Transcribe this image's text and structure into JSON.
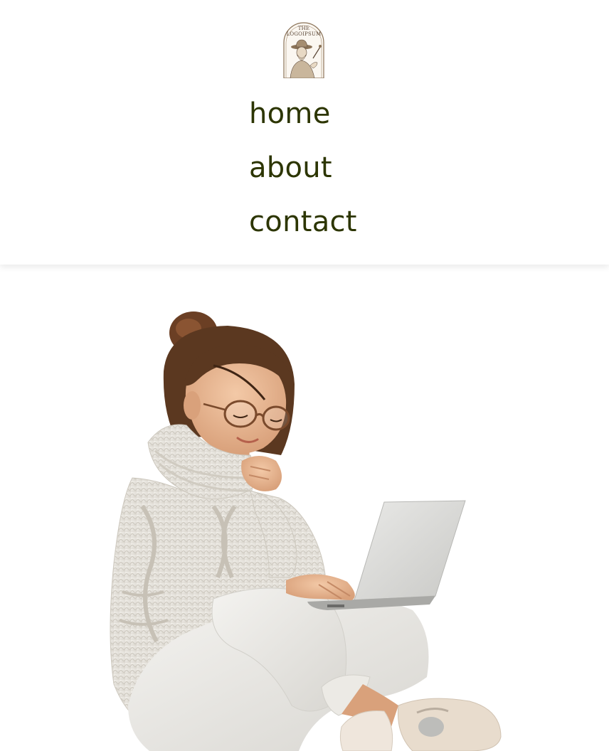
{
  "header": {
    "logo": {
      "icon": "logo-emblem-icon",
      "text": "LOGOIPSUM",
      "small_text": "THE"
    }
  },
  "nav": {
    "items": [
      {
        "label": "home"
      },
      {
        "label": "about"
      },
      {
        "label": "contact"
      }
    ]
  },
  "hero": {
    "image": "woman-with-laptop-illustration"
  },
  "colors": {
    "nav_text": "#2c3500",
    "background": "#ffffff",
    "logo_ink": "#5a4636"
  }
}
